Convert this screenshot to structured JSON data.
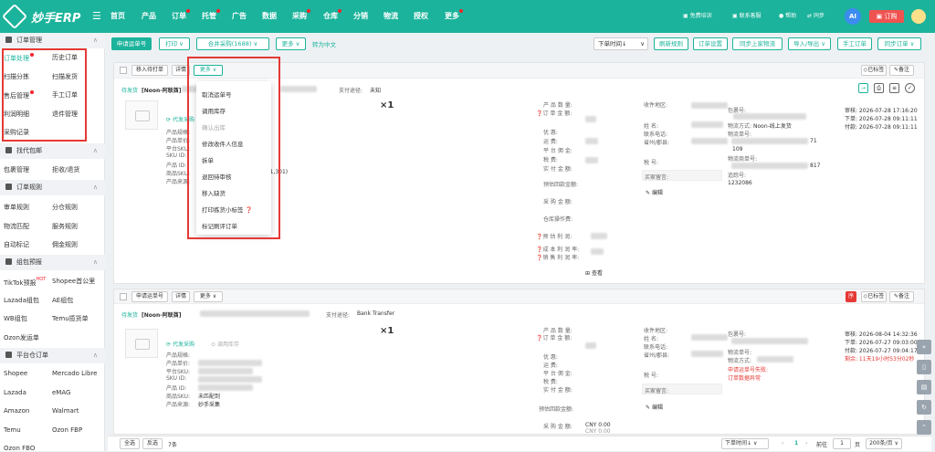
{
  "app": {
    "logo_text": "妙手ERP",
    "brand_color": "#1bb39b",
    "accent_red": "#e53935"
  },
  "topnav": [
    "首页",
    "产品",
    "订单",
    "托管",
    "广告",
    "数据",
    "采购",
    "仓库",
    "分销",
    "物流",
    "授权",
    "更多"
  ],
  "topright": {
    "training": "免费培训",
    "service": "联系客服",
    "help": "帮助",
    "sync": "同步",
    "ai": "AI",
    "order": "订购"
  },
  "sidebar": {
    "sec_order": "订单管理",
    "order_items": [
      "订单处理",
      "历史订单",
      "扫描分拣",
      "扫描发货",
      "售后管理",
      "手工订单",
      "利润明细",
      "退件管理",
      "采购记录"
    ],
    "sec_agent": "找代包邮",
    "agent_items": [
      "包裹管理",
      "拒收/退货"
    ],
    "sec_rules": "订单规则",
    "rule_items": [
      "审单规则",
      "分仓规则",
      "物流匹配",
      "服务规则",
      "自动标记",
      "佣金规则"
    ],
    "sec_pack": "组包预报",
    "pack_items": [
      "TikTok预报",
      "Shopee首公里",
      "Lazada组包",
      "AE组包",
      "WB组包",
      "Temu揽货单",
      "Ozon发运单"
    ],
    "pack_hot": "HOT",
    "sec_platform": "平台仓订单",
    "platform_items": [
      "Shopee",
      "Mercado Libre",
      "Lazada",
      "eMAG",
      "Amazon",
      "Walmart",
      "Temu",
      "Ozon FBP",
      "Ozon FBO"
    ]
  },
  "toolbar": {
    "apply": "申请运单号",
    "print": "打印",
    "merge": "合并采购(1688)",
    "more": "更多",
    "translate": "转为中文",
    "sort": "下单时间↓",
    "refresh": "刷新规则",
    "settings": "订单设置",
    "sync_logistics": "同步上家物流",
    "import_export": "导入/导出",
    "manual": "手工订单",
    "sync_orders": "同步订单"
  },
  "order1": {
    "btn_pending": "移入待打单",
    "btn_detail": "详情",
    "btn_more": "更多",
    "status": "待发货",
    "shop": "[Noon-阿联酋]",
    "pay_label": "支付途径:",
    "pay_value": "未知",
    "btn_tag": "已标签",
    "btn_note": "备注",
    "agent": "代发采购",
    "qty": "×1",
    "prod_labels": [
      "产品规格:",
      "产品单价:",
      "平台SKU:",
      "SKU ID:",
      "产品 ID:",
      "商品SKU:",
      "产品来源:"
    ],
    "sku_frag": "111,301)",
    "mid_labels": [
      "产 品 数 量:",
      "订 单 金 额:",
      "优     惠:",
      "运     费:",
      "平 台 佣 金:",
      "税     费:",
      "实 付 金 额:",
      "预估回款金额:",
      "采 购 金 额:",
      "仓库操作费:",
      "预 估 利 润:",
      "成 本 利 润 率:",
      "销 售 利 润 率:"
    ],
    "view": "查看",
    "recv_labels": [
      "收件地区:",
      "姓     名:",
      "联系电话:",
      "省州/郡县:",
      "税     号:",
      "买家留言:"
    ],
    "edit": "编辑",
    "pkg_labels": [
      "包裹号:",
      "物流方式:",
      "物流单号:",
      "物流商单号:",
      "追踪号:"
    ],
    "ship_method": "Noon-线上发货",
    "tracking_frag": "71",
    "tracking2": "1232086",
    "frag_a": "109",
    "frag_b": "817",
    "times": [
      "审核: 2026-07-28 17:16:20",
      "下单: 2026-07-28 09:11:11",
      "付款: 2026-07-28 09:11:11"
    ]
  },
  "dropdown": [
    "取消运单号",
    "调用库存",
    "确认出库",
    "修改收件人信息",
    "拆单",
    "退回待审核",
    "移入缺货",
    "打印拣货小标签",
    "标记刷评订单"
  ],
  "order2": {
    "btn_apply": "申请运单号",
    "btn_detail": "详情",
    "btn_more": "更多",
    "status": "待发货",
    "shop": "[Noon-阿联酋]",
    "pay_label": "支付途径:",
    "pay_value": "Bank Transfer",
    "btn_tag": "已标签",
    "btn_note": "备注",
    "red_tag": "序",
    "agent": "代发采购",
    "use_stock": "调用库存",
    "qty": "×1",
    "prod_labels": [
      "产品规格:",
      "产品单价:",
      "平台SKU:",
      "SKU ID:",
      "产品 ID:",
      "商品SKU:",
      "产品来源:"
    ],
    "sku_status": "未匹配到",
    "source": "妙手采集",
    "mid_labels": [
      "产 品 数 量:",
      "订 单 金 额:",
      "优     惠:",
      "运     费:",
      "平 台 佣 金:",
      "税     费:",
      "实 付 金 额:",
      "预估回款金额:",
      "采 购 金 额:"
    ],
    "purchase": "CNY 0.00",
    "purchase2": "CNY 0.00",
    "recv_labels": [
      "收件地区:",
      "姓     名:",
      "联系电话:",
      "省州/郡县:",
      "税     号:",
      "买家留言:"
    ],
    "edit": "编辑",
    "pkg_labels": [
      "包裹号:",
      "物流单号:",
      "物流方式:"
    ],
    "err1": "申请运单号失败:",
    "err2": "订单数据异常",
    "times": [
      "审核: 2026-08-04 14:32:36",
      "下单: 2026-07-27 09:03:00",
      "付款: 2026-07-27 09:04:17"
    ],
    "remain": "剩余: 11天19小时53分02秒"
  },
  "footer": {
    "all": "全选",
    "invert": "反选",
    "count": "7条",
    "sort": "下单时间↓",
    "goto": "前往",
    "page": "1",
    "page_unit": "页",
    "per": "200条/页",
    "cur": "1"
  }
}
